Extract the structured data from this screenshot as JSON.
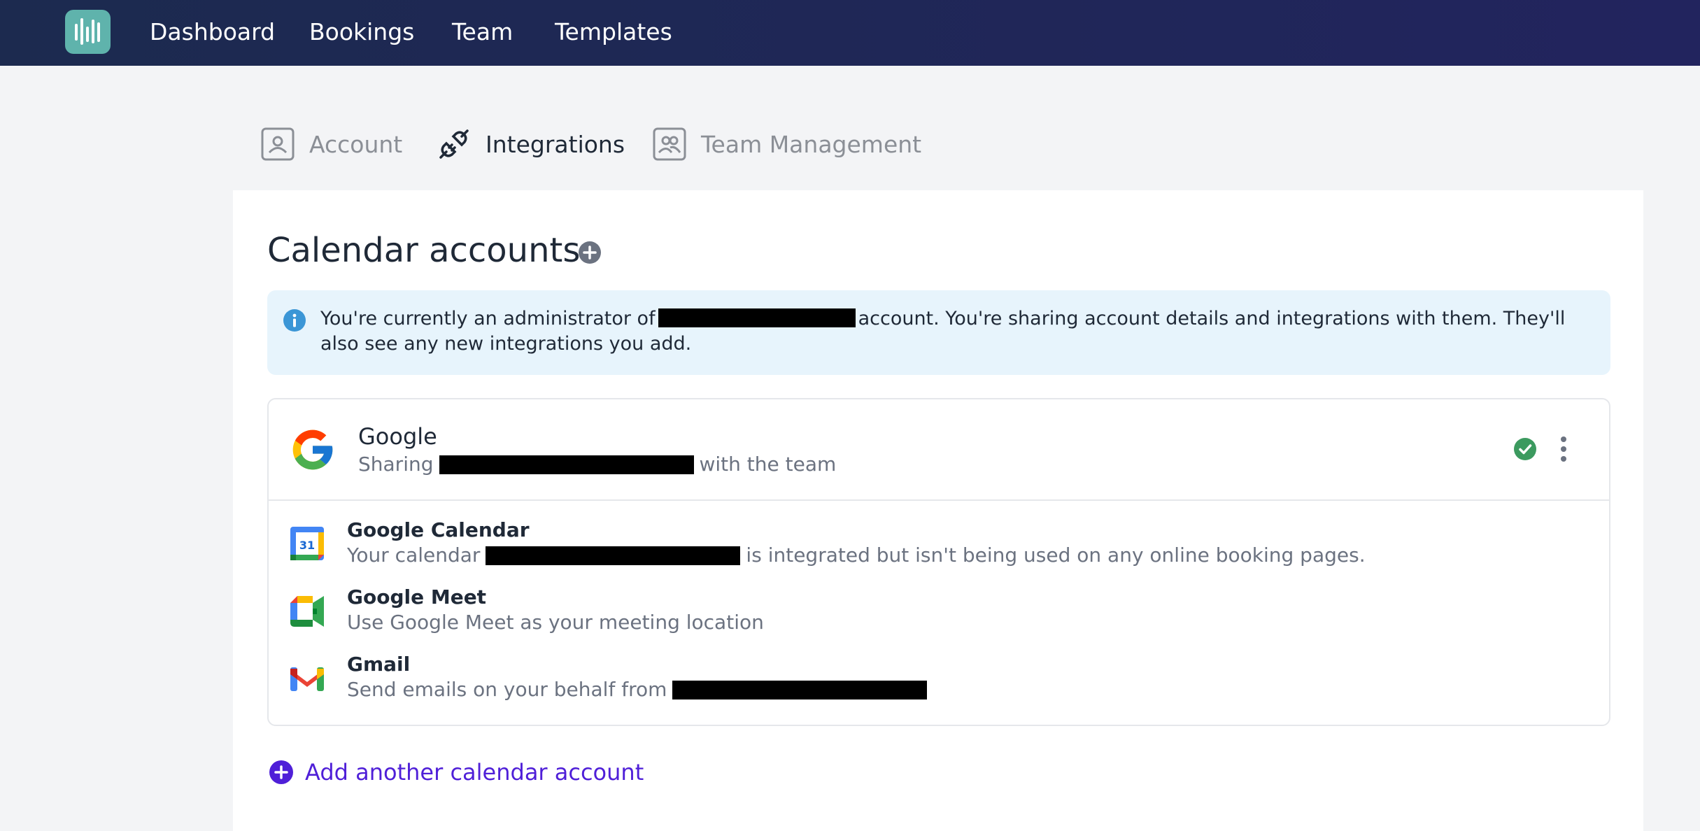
{
  "nav": {
    "items": [
      "Dashboard",
      "Bookings",
      "Team",
      "Templates"
    ]
  },
  "tabs": [
    {
      "label": "Account",
      "icon": "user-square-icon",
      "active": false
    },
    {
      "label": "Integrations",
      "icon": "plug-icon",
      "active": true
    },
    {
      "label": "Team Management",
      "icon": "users-square-icon",
      "active": false
    }
  ],
  "calendar_section": {
    "title": "Calendar accounts",
    "info_text_before": "You're currently an administrator of",
    "info_text_after": "account. You're sharing account details and integrations with them. They'll also see any new integrations you add."
  },
  "provider": {
    "name": "Google",
    "sharing_prefix": "Sharing",
    "sharing_suffix": "with the team",
    "status": "connected"
  },
  "services": [
    {
      "name": "Google Calendar",
      "desc_before": "Your calendar",
      "desc_after": "is integrated but isn't being used on any online booking pages.",
      "icon": "google-calendar-icon"
    },
    {
      "name": "Google Meet",
      "desc_before": "Use Google Meet as your meeting location",
      "desc_after": "",
      "icon": "google-meet-icon"
    },
    {
      "name": "Gmail",
      "desc_before": "Send emails on your behalf from",
      "desc_after": "",
      "icon": "gmail-icon"
    }
  ],
  "add_link": {
    "label": "Add another calendar account"
  },
  "colors": {
    "nav_bg": "#1c2a4f",
    "logo_bg": "#5fb3ac",
    "accent": "#4f1fd8",
    "info_bg": "#e7f4fc",
    "success": "#3c9a5f"
  }
}
